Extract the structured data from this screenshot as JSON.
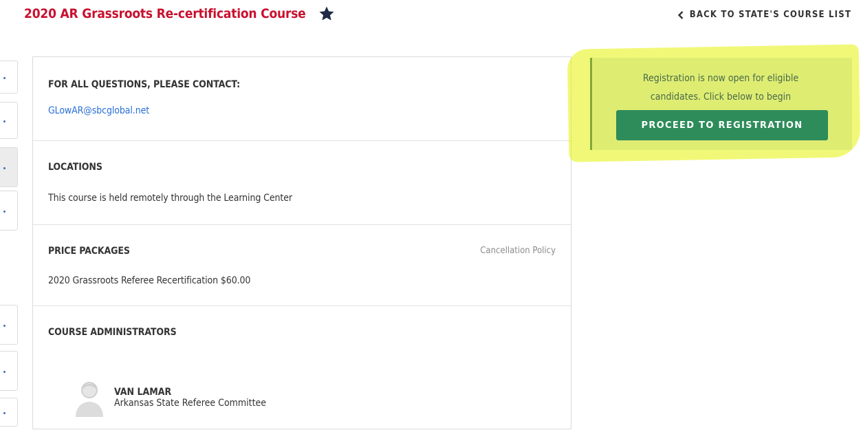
{
  "header": {
    "title": "2020 AR Grassroots Re-certification Course",
    "favorite_icon": "star-icon",
    "back_link": "BACK TO STATE'S COURSE LIST"
  },
  "contact": {
    "heading": "FOR ALL QUESTIONS, PLEASE CONTACT:",
    "email": "GLowAR@sbcglobal.net"
  },
  "locations": {
    "heading": "LOCATIONS",
    "text": "This course is held remotely through the Learning Center"
  },
  "price_packages": {
    "heading": "PRICE PACKAGES",
    "cancellation_link": "Cancellation Policy",
    "package": "2020 Grassroots Referee Recertification $60.00"
  },
  "administrators": {
    "heading": "COURSE ADMINISTRATORS",
    "name": "VAN LAMAR",
    "organization": "Arkansas State Referee Committee",
    "avatar_icon": "user-avatar-icon"
  },
  "registration": {
    "message_line1": "Registration is now open for eligible",
    "message_line2": "candidates. Click below to begin",
    "button_label": "PROCEED TO REGISTRATION"
  },
  "colors": {
    "title_red": "#c8102e",
    "link_blue": "#2a6fd6",
    "button_green": "#2e8c5a",
    "panel_blue": "#d4e6f1",
    "highlight_yellow": "#e6f30a"
  }
}
